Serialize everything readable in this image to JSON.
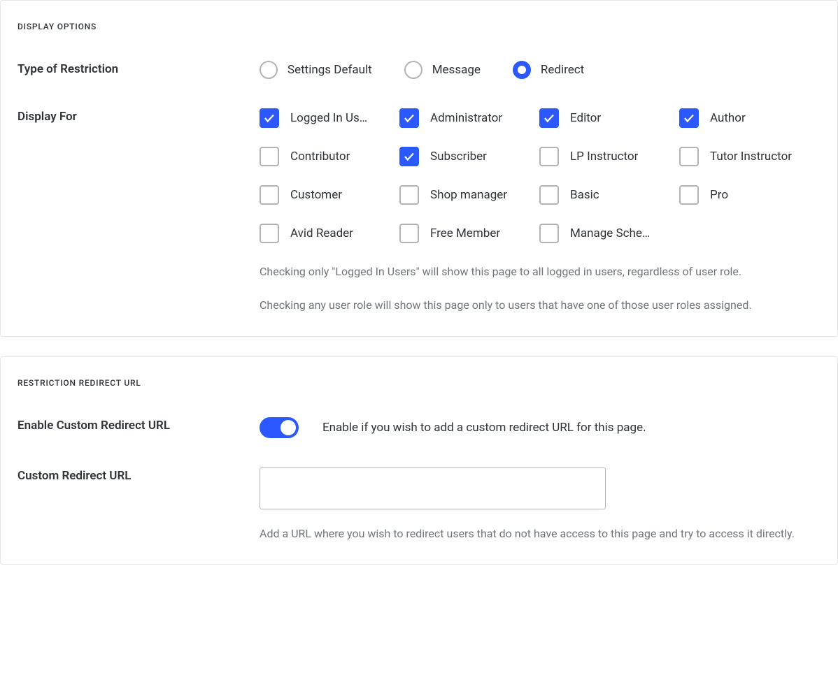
{
  "displayOptions": {
    "title": "DISPLAY OPTIONS",
    "typeOfRestriction": {
      "label": "Type of Restriction",
      "options": [
        {
          "id": "settings-default",
          "label": "Settings Default",
          "selected": false
        },
        {
          "id": "message",
          "label": "Message",
          "selected": false
        },
        {
          "id": "redirect",
          "label": "Redirect",
          "selected": true
        }
      ]
    },
    "displayFor": {
      "label": "Display For",
      "roles": [
        {
          "id": "logged-in-users",
          "label": "Logged In Us…",
          "checked": true
        },
        {
          "id": "administrator",
          "label": "Administrator",
          "checked": true
        },
        {
          "id": "editor",
          "label": "Editor",
          "checked": true
        },
        {
          "id": "author",
          "label": "Author",
          "checked": true
        },
        {
          "id": "contributor",
          "label": "Contributor",
          "checked": false
        },
        {
          "id": "subscriber",
          "label": "Subscriber",
          "checked": true
        },
        {
          "id": "lp-instructor",
          "label": "LP Instructor",
          "checked": false
        },
        {
          "id": "tutor-instructor",
          "label": "Tutor Instructor",
          "checked": false
        },
        {
          "id": "customer",
          "label": "Customer",
          "checked": false
        },
        {
          "id": "shop-manager",
          "label": "Shop manager",
          "checked": false
        },
        {
          "id": "basic",
          "label": "Basic",
          "checked": false
        },
        {
          "id": "pro",
          "label": "Pro",
          "checked": false
        },
        {
          "id": "avid-reader",
          "label": "Avid Reader",
          "checked": false
        },
        {
          "id": "free-member",
          "label": "Free Member",
          "checked": false
        },
        {
          "id": "manage-schedule",
          "label": "Manage Sche…",
          "checked": false
        }
      ],
      "help1": "Checking only \"Logged In Users\" will show this page to all logged in users, regardless of user role.",
      "help2": "Checking any user role will show this page only to users that have one of those user roles assigned."
    }
  },
  "redirectUrl": {
    "title": "RESTRICTION REDIRECT URL",
    "enableCustom": {
      "label": "Enable Custom Redirect URL",
      "enabled": true,
      "description": "Enable if you wish to add a custom redirect URL for this page."
    },
    "customUrl": {
      "label": "Custom Redirect URL",
      "value": "",
      "help": "Add a URL where you wish to redirect users that do not have access to this page and try to access it directly."
    }
  }
}
